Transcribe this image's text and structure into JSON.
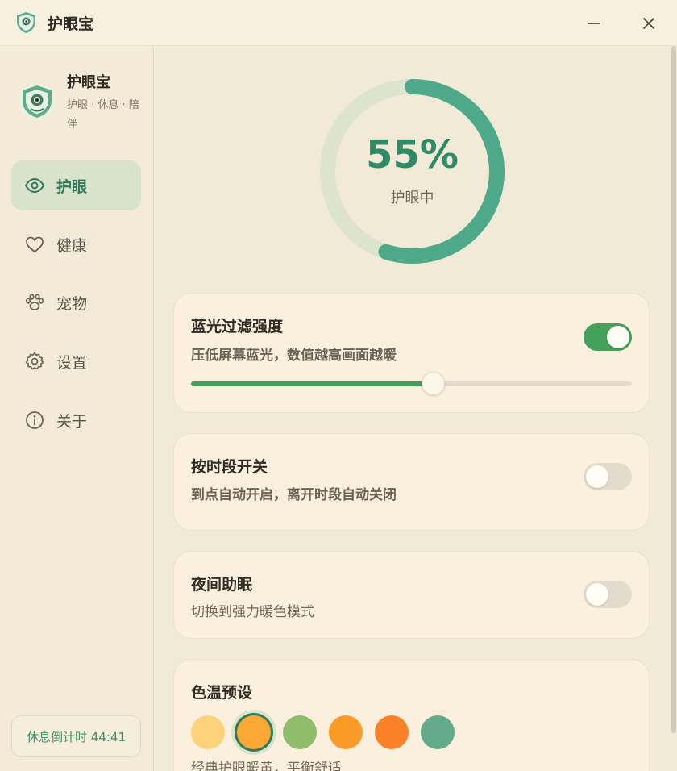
{
  "window": {
    "title": "护眼宝",
    "app_icon": "shield-eye-icon",
    "min_icon": "minimize-icon",
    "close_icon": "close-icon"
  },
  "sidebar": {
    "brand_name": "护眼宝",
    "brand_tagline": "护眼 · 休息 · 陪伴",
    "items": [
      {
        "label": "护眼",
        "icon": "eye-icon",
        "active": true
      },
      {
        "label": "健康",
        "icon": "heart-icon",
        "active": false
      },
      {
        "label": "宠物",
        "icon": "paw-icon",
        "active": false
      },
      {
        "label": "设置",
        "icon": "gear-icon",
        "active": false
      },
      {
        "label": "关于",
        "icon": "info-icon",
        "active": false
      }
    ],
    "break_timer": "休息倒计时 44:41"
  },
  "status": {
    "percent_value": 0.55,
    "percent_text": "55%",
    "label": "护眼中"
  },
  "cards": {
    "blue_filter": {
      "title": "蓝光过滤强度",
      "desc": "压低屏幕蓝光，数值越高画面越暖",
      "enabled": true,
      "level": 0.55
    },
    "schedule": {
      "title": "按时段开关",
      "desc": "到点自动开启，离开时段自动关闭",
      "enabled": false
    },
    "night": {
      "title": "夜间助眠",
      "desc": "切换到强力暖色模式",
      "enabled": false
    },
    "presets": {
      "title": "色温预设",
      "swatches": [
        "#fdd27a",
        "#fba934",
        "#8fbd6a",
        "#fb9b27",
        "#fb8128",
        "#63ab8b"
      ],
      "selected_index": 1,
      "desc": "经典护眼暖黄，平衡舒适"
    }
  },
  "colors": {
    "accent": "#2f8a66",
    "toggle_on": "#45a05a",
    "background": "#f6eedc"
  }
}
